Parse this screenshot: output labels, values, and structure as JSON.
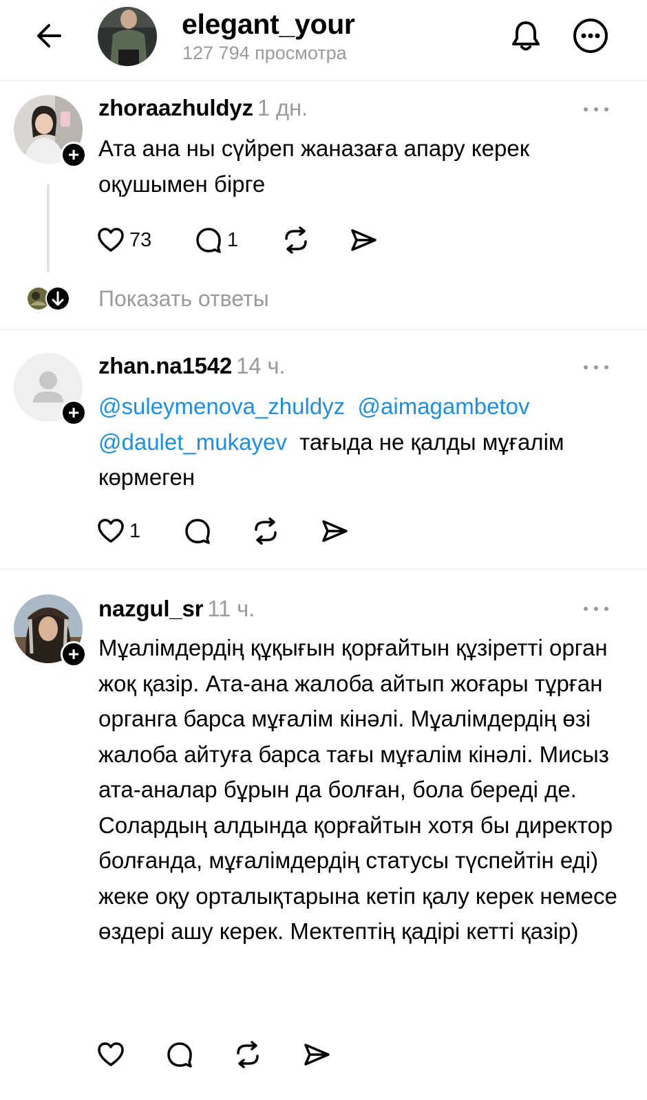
{
  "header": {
    "title": "elegant_your",
    "views": "127 794 просмотра"
  },
  "posts": [
    {
      "username": "zhoraazhuldyz",
      "time": "1 дн.",
      "text": "Ата ана ны сүйреп жаназаға апару керек оқушымен бірге",
      "likes": "73",
      "replies": "1"
    },
    {
      "username": "zhan.na1542",
      "time": "14 ч.",
      "mentions": [
        "@suleymenova_zhuldyz",
        "@aimagambetov",
        "@daulet_mukayev"
      ],
      "text": "тағыда не қалды мұғалім көрмеген",
      "likes": "1"
    },
    {
      "username": "nazgul_sr",
      "time": "11 ч.",
      "text": "Мұалімдердің құқығын қорғайтын құзіретті орган жоқ қазір. Ата-ана жалоба айтып жоғары тұрған органга барса мұғалім кінәлі. Мұалімдердің өзі жалоба айтуға барса тағы мұғалім кінәлі. Мисыз ата-аналар бұрын да болған, бола береді де. Солардың алдында қорғайтын хотя бы директор болғанда, мұғалімдердің статусы түспейтін еді) жеке оқу орталықтарына кетіп қалу керек немесе өздері ашу керек. Мектептің қадірі кетті қазір)"
    }
  ],
  "thread": {
    "show_replies": "Показать ответы"
  },
  "icons": {
    "back": "arrow-left-icon",
    "bell": "bell-icon",
    "more": "more-circle-icon",
    "like": "heart-icon",
    "reply": "comment-icon",
    "repost": "repost-icon",
    "share": "send-icon"
  }
}
